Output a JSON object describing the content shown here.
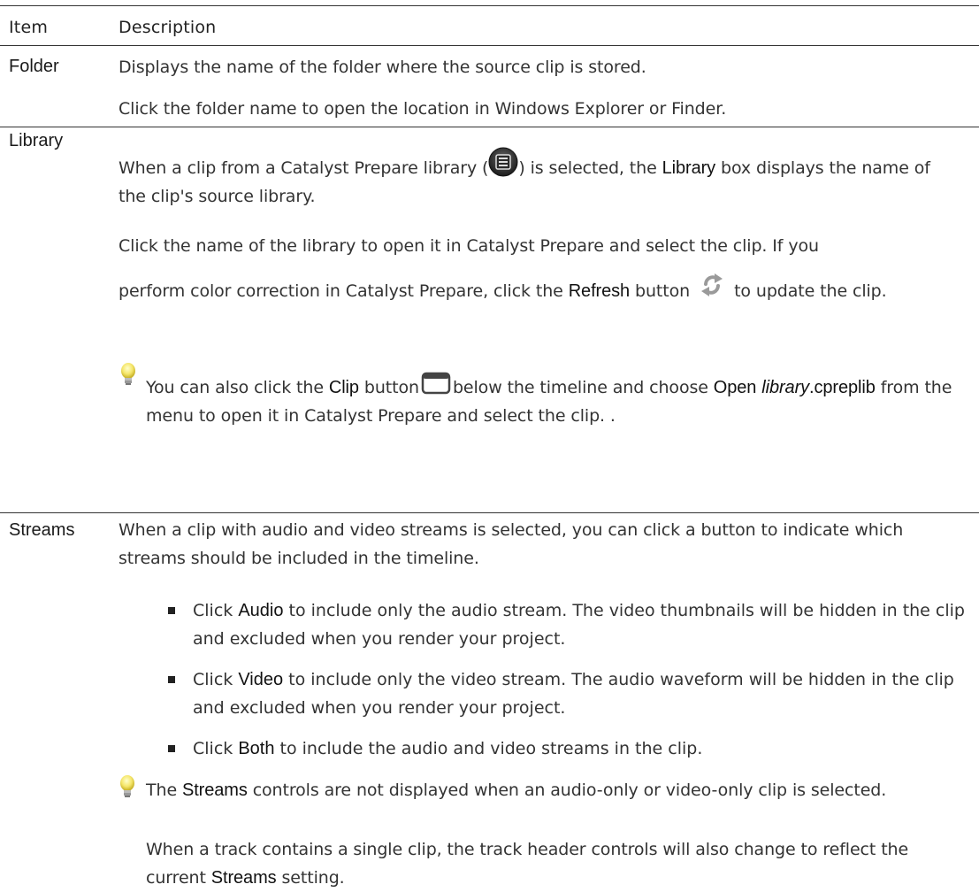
{
  "header": {
    "item": "Item",
    "description": "Description"
  },
  "folder": {
    "item": "Folder",
    "p1": "Displays the name of the folder where the source clip is stored.",
    "p2": "Click the folder name to open the location in Windows Explorer or Finder."
  },
  "library": {
    "item": "Library",
    "p1_a": "When a clip from a Catalyst Prepare library (",
    "p1_b": ") is selected, the ",
    "p1_bold": "Library",
    "p1_c": " box displays the name of the clip's source library.",
    "p2": "Click the name of the library to open it in Catalyst Prepare and select the clip. If you",
    "p3_a": "perform color correction in Catalyst Prepare, click the ",
    "p3_bold": "Refresh",
    "p3_b": " button",
    "p3_c": "to update the clip.",
    "tip_a": "You can also click the ",
    "tip_bold1": "Clip",
    "tip_b": " button",
    "tip_c": "below the timeline and choose ",
    "tip_bold2": "Open",
    "tip_ital": "library",
    "tip_bold3": ".cpreplib",
    "tip_d": " from the menu to open it in Catalyst Prepare and select the clip. ."
  },
  "streams": {
    "item": "Streams",
    "p1": "When a clip with audio and video streams is selected, you can click a button to indicate which streams should be included in the timeline.",
    "bullets": [
      {
        "a": "Click ",
        "bold": "Audio",
        "b": " to include only the audio stream. The video thumbnails will be hidden in the clip and excluded when you render your project."
      },
      {
        "a": "Click ",
        "bold": "Video",
        "b": " to include only the video stream. The audio waveform will be hidden in the clip and excluded when you render your project."
      },
      {
        "a": "Click ",
        "bold": "Both",
        "b": " to include the audio and video streams in the clip."
      }
    ],
    "tip_a": "The ",
    "tip_bold": "Streams",
    "tip_b": " controls are not displayed when an audio-only or video-only clip is selected.",
    "p2_a": "When a track contains a single clip, the track header controls will also change to reflect the current ",
    "p2_bold": "Streams",
    "p2_b": " setting."
  }
}
